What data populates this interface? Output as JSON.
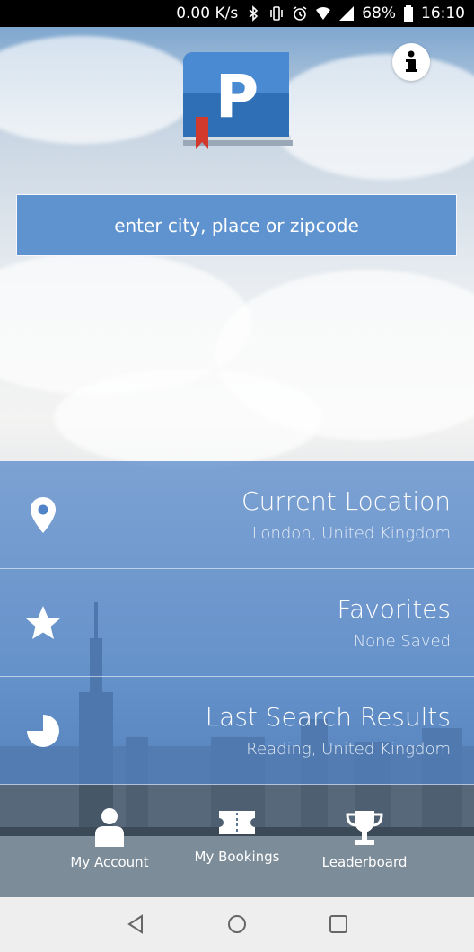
{
  "status_bar": {
    "speed": "0.00 K/s",
    "battery": "68%",
    "time": "16:10"
  },
  "search": {
    "placeholder": "enter city, place or zipcode"
  },
  "menu": [
    {
      "title": "Current Location",
      "subtitle": "London, United Kingdom",
      "icon": "location-pin-icon"
    },
    {
      "title": "Favorites",
      "subtitle": "None Saved",
      "icon": "star-icon"
    },
    {
      "title": "Last Search Results",
      "subtitle": "Reading, United Kingdom",
      "icon": "history-pie-icon"
    }
  ],
  "bottom_nav": [
    {
      "label": "My Account",
      "icon": "person-icon"
    },
    {
      "label": "My Bookings",
      "icon": "ticket-icon"
    },
    {
      "label": "Leaderboard",
      "icon": "trophy-icon"
    }
  ],
  "colors": {
    "accent": "#5f93cf",
    "menu_bg": "#5083c8"
  }
}
